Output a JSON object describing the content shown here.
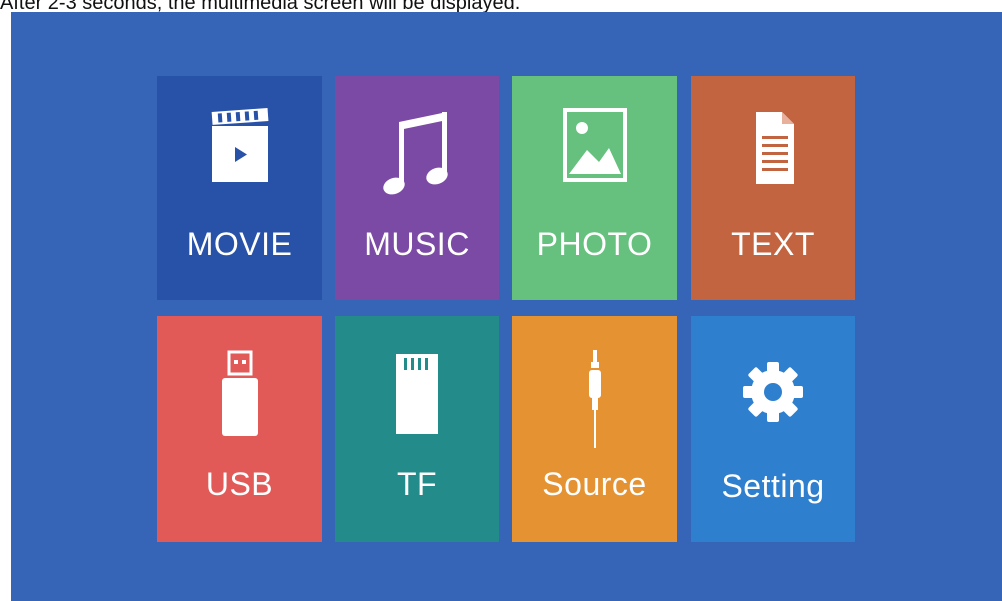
{
  "caption": "After 2-3 seconds, the multimedia screen will be displayed.",
  "colors": {
    "screen_bg": "#3664b7",
    "movie": "#2852a8",
    "music": "#7b4aa4",
    "photo": "#66c07e",
    "text": "#c36440",
    "usb": "#e25a58",
    "tf": "#238c8a",
    "source": "#e49232",
    "setting": "#2e7fcd"
  },
  "tiles": [
    {
      "label": "MOVIE",
      "icon": "movie-clapper-icon"
    },
    {
      "label": "MUSIC",
      "icon": "music-note-icon"
    },
    {
      "label": "PHOTO",
      "icon": "photo-icon"
    },
    {
      "label": "TEXT",
      "icon": "document-icon"
    },
    {
      "label": "USB",
      "icon": "usb-drive-icon"
    },
    {
      "label": "TF",
      "icon": "sd-card-icon"
    },
    {
      "label": "Source",
      "icon": "audio-jack-icon"
    },
    {
      "label": "Setting",
      "icon": "gear-icon"
    }
  ]
}
